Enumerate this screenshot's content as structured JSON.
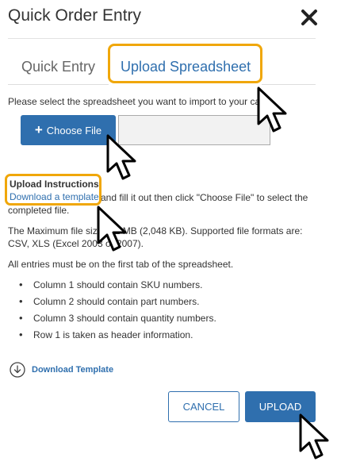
{
  "dialog": {
    "title": "Quick Order Entry"
  },
  "tabs": {
    "quick_entry": "Quick Entry",
    "upload_spreadsheet": "Upload Spreadsheet"
  },
  "instruction": "Please select the spreadsheet you want to import to your ca",
  "file_picker": {
    "choose_label": "Choose File",
    "file_value": ""
  },
  "upload_instructions": {
    "heading": "Upload Instructions",
    "template_link": "Download a template",
    "paragraph1_rest": "and fill it out then click \"Choose File\" to select the completed file.",
    "paragraph2": "The Maximum file size is 2 MB (2,048 KB). Supported file formats are: CSV, XLS (Excel 2003 or 2007).",
    "paragraph3": "All entries must be on the first tab of the spreadsheet.",
    "bullets": [
      "Column 1 should contain SKU numbers.",
      "Column 2 should contain part numbers.",
      "Column 3 should contain quantity numbers.",
      "Row 1 is taken as header information."
    ]
  },
  "download_template": "Download Template",
  "actions": {
    "cancel": "CANCEL",
    "upload": "UPLOAD"
  },
  "colors": {
    "accent": "#2f6fae",
    "highlight": "#f0a70a"
  },
  "icons": [
    "close-icon",
    "plus-icon",
    "download-icon",
    "cursor-arrow-icon"
  ]
}
